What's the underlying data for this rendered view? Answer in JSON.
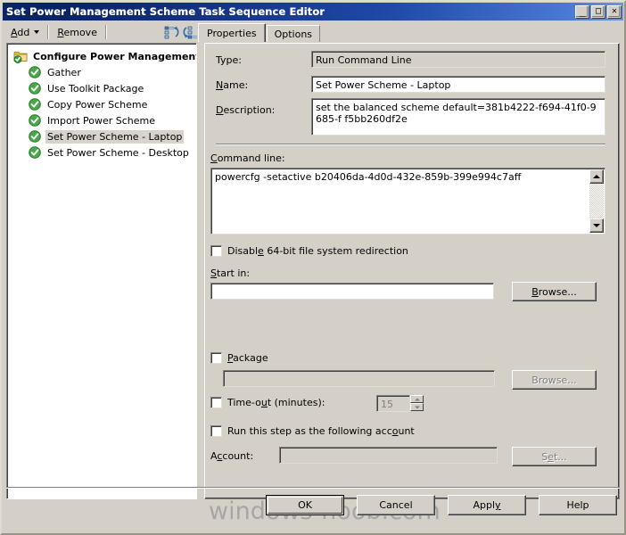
{
  "window": {
    "title": "Set Power Management Scheme Task Sequence Editor",
    "controls": {
      "minimize": "_",
      "maximize": "□",
      "close": "✕"
    }
  },
  "toolbar": {
    "add_label": "Add",
    "remove_label": "Remove",
    "move_up_icon": "move-up-icon",
    "move_down_icon": "move-down-icon"
  },
  "tabs": [
    {
      "label": "Properties",
      "active": true
    },
    {
      "label": "Options",
      "active": false
    }
  ],
  "tree": {
    "root": {
      "label": "Configure Power Management",
      "icon": "folder-checked-icon"
    },
    "items": [
      {
        "label": "Gather",
        "icon": "green-check-icon",
        "selected": false
      },
      {
        "label": "Use Toolkit Package",
        "icon": "green-check-icon",
        "selected": false
      },
      {
        "label": "Copy Power Scheme",
        "icon": "green-check-icon",
        "selected": false
      },
      {
        "label": "Import Power Scheme",
        "icon": "green-check-icon",
        "selected": false
      },
      {
        "label": "Set Power Scheme - Laptop",
        "icon": "green-check-icon",
        "selected": true
      },
      {
        "label": "Set Power Scheme - Desktop",
        "icon": "green-check-icon",
        "selected": false
      }
    ]
  },
  "properties": {
    "type_label": "Type:",
    "type_value": "Run Command Line",
    "name_label": "Name:",
    "name_value": "Set Power Scheme - Laptop",
    "description_label": "Description:",
    "description_value": "set the balanced scheme default=381b4222-f694-41f0-9685-f f5bb260df2e",
    "command_line_label": "Command line:",
    "command_line_value": "powercfg -setactive b20406da-4d0d-432e-859b-399e994c7aff",
    "disable_redirection_label": "Disable 64-bit file system redirection",
    "disable_redirection_checked": false,
    "start_in_label": "Start in:",
    "start_in_value": "",
    "start_in_browse_label": "Browse...",
    "package_label": "Package",
    "package_checked": false,
    "package_value": "",
    "package_browse_label": "Browse...",
    "timeout_label": "Time-out (minutes):",
    "timeout_checked": false,
    "timeout_value": "15",
    "run_as_label": "Run this step as the following account",
    "run_as_checked": false,
    "account_label": "Account:",
    "account_value": "",
    "account_set_label": "Set..."
  },
  "footer": {
    "watermark": "windows-noob.com",
    "buttons": [
      {
        "label": "OK",
        "default": true
      },
      {
        "label": "Cancel",
        "default": false
      },
      {
        "label": "Apply",
        "default": false
      },
      {
        "label": "Help",
        "default": false
      }
    ]
  },
  "colors": {
    "title_start": "#0a246a",
    "title_end": "#6d96e0",
    "face": "#d4d0c8",
    "check_green": "#3d9d3d",
    "folder_yellow": "#f5d272",
    "selection": "#d8d4cc",
    "watermark": "#a6a6a6"
  }
}
